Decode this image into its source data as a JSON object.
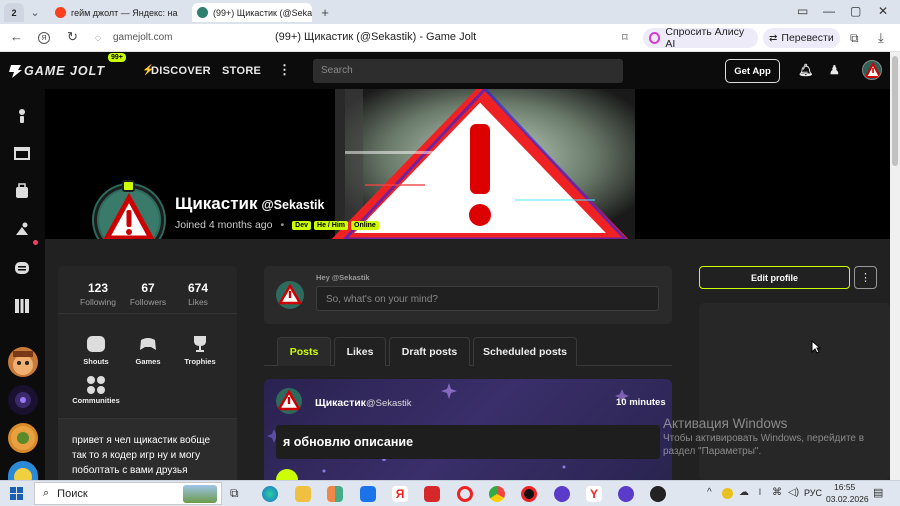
{
  "browser": {
    "tab_counter": "2",
    "tabs": [
      {
        "label": "гейм джолт — Яндекс: на"
      },
      {
        "label": "(99+) Щикастик (@Seka"
      }
    ],
    "new_tab_label": "+",
    "url": "gamejolt.com",
    "page_title": "(99+) Щикастик (@Sekastik) - Game Jolt",
    "alice_button": "Спросить Алису AI",
    "translate_button": "Перевести"
  },
  "site_nav": {
    "logo_text": "GAME JOLT",
    "notification_count": "99+",
    "discover": "DISCOVER",
    "store": "STORE",
    "search_placeholder": "Search",
    "get_app": "Get App"
  },
  "profile": {
    "name": "Щикастик",
    "username": "@Sekastik",
    "joined": "Joined 4 months ago",
    "tags": [
      "Dev",
      "He / Him",
      "Online"
    ],
    "stats": [
      {
        "value": "123",
        "label": "Following"
      },
      {
        "value": "67",
        "label": "Followers"
      },
      {
        "value": "674",
        "label": "Likes"
      }
    ],
    "quick_links": [
      {
        "label": "Shouts",
        "icon": "shouts-icon"
      },
      {
        "label": "Games",
        "icon": "games-icon"
      },
      {
        "label": "Trophies",
        "icon": "trophy-icon"
      },
      {
        "label": "Communities",
        "icon": "communities-icon"
      }
    ],
    "bio": "привет я чел щикастик вобще так то я кодер игр ну и могу поболтать с вами друзья"
  },
  "composer": {
    "greeting": "Hey @Sekastik",
    "placeholder": "So, what's on your mind?"
  },
  "feed_tabs": [
    "Posts",
    "Likes",
    "Draft posts",
    "Scheduled posts"
  ],
  "post": {
    "author_name": "Щикастик",
    "author_username": "@Sekastik",
    "time": "10 minutes",
    "text": "я обновлю описание"
  },
  "actions": {
    "edit_profile": "Edit profile"
  },
  "windows_watermark": {
    "title": "Активация Windows",
    "line1": "Чтобы активировать Windows, перейдите в",
    "line2": "раздел \"Параметры\"."
  },
  "taskbar": {
    "search_label": "Поиск",
    "language": "РУС",
    "time": "16:55",
    "date": "03.02.2026"
  },
  "colors": {
    "accent": "#ccff00",
    "nav_bg": "#0c0c0c",
    "content_bg": "#212121"
  }
}
